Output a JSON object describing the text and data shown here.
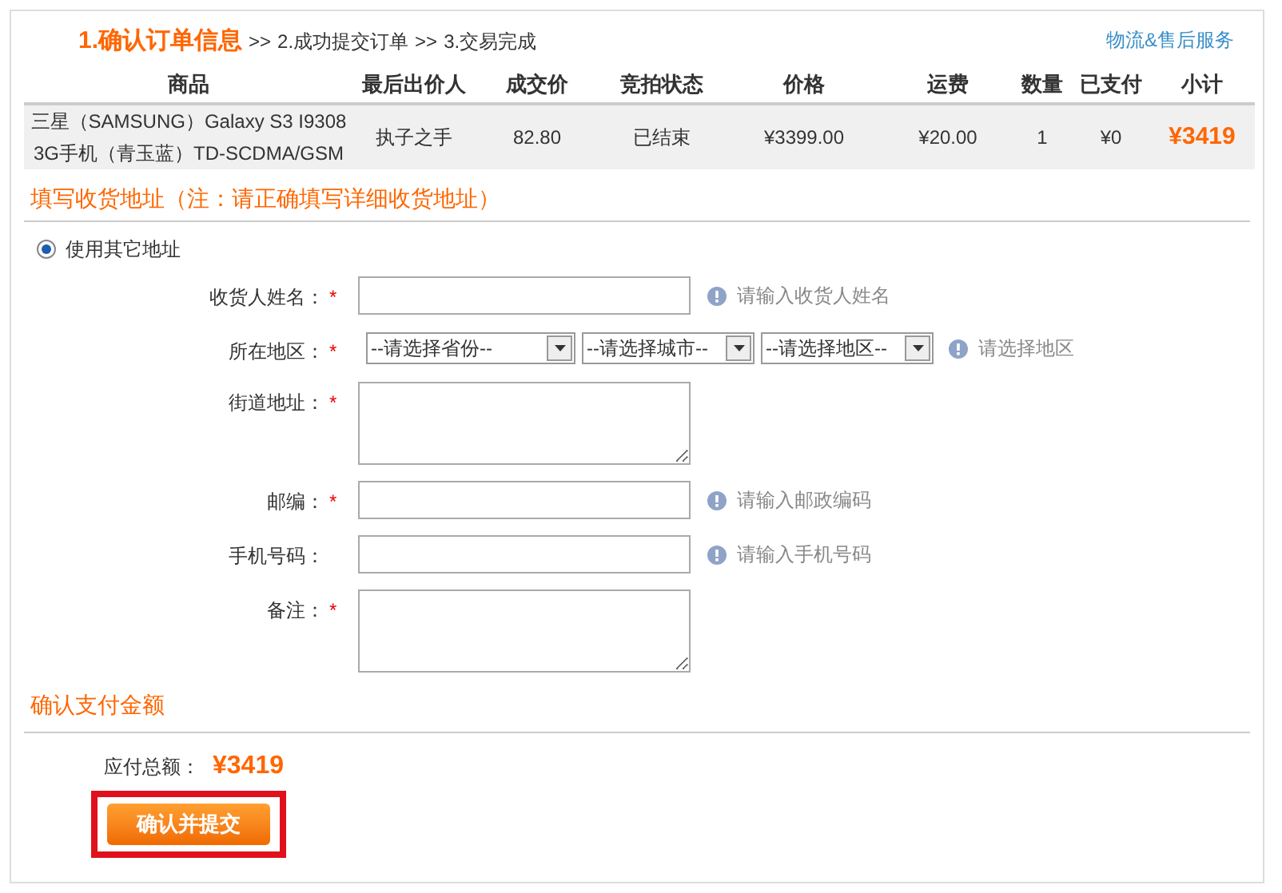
{
  "steps": [
    {
      "label": "1.确认订单信息",
      "selected": true
    },
    {
      "prefix": ">>",
      "label": "2.成功提交订单",
      "selected": false
    },
    {
      "prefix": ">>",
      "label": "3.交易完成",
      "selected": false
    }
  ],
  "service_link": "物流&售后服务",
  "table": {
    "columns": [
      "商品",
      "最后出价人",
      "成交价",
      "竞拍状态",
      "价格",
      "运费",
      "数量",
      "已支付",
      "小计"
    ],
    "rows": [
      {
        "cells": [
          "三星（SAMSUNG）Galaxy S3 I9308 3G手机（青玉蓝）TD-SCDMA/GSM",
          "执子之手",
          "82.80",
          "已结束",
          "¥3399.00",
          "¥20.00",
          "1",
          "¥0",
          "¥3419"
        ]
      }
    ]
  },
  "address_section": {
    "title": "填写收货地址（注：请正确填写详细收货地址）",
    "address_option": {
      "label": "使用其它地址",
      "selected": true
    },
    "fields": [
      {
        "kind": "text",
        "label": "收货人姓名：",
        "required_mark": "*",
        "hint": "请输入收货人姓名"
      },
      {
        "kind": "region",
        "label": "所在地区：",
        "required_mark": "*",
        "selects": [
          "--请选择省份--",
          "--请选择城市--",
          "--请选择地区--"
        ],
        "hint": "请选择地区"
      },
      {
        "kind": "textarea",
        "label": "街道地址：",
        "required_mark": "*"
      },
      {
        "kind": "text",
        "label": "邮编：",
        "required_mark": "*",
        "hint": "请输入邮政编码"
      },
      {
        "kind": "text",
        "label": "手机号码：",
        "hint": "请输入手机号码"
      },
      {
        "kind": "textarea",
        "label": "备注：",
        "required_mark": "*"
      }
    ]
  },
  "payment_section": {
    "title": "确认支付金额",
    "total_label": "应付总额：",
    "total": "¥3419",
    "submit": "确认并提交"
  }
}
